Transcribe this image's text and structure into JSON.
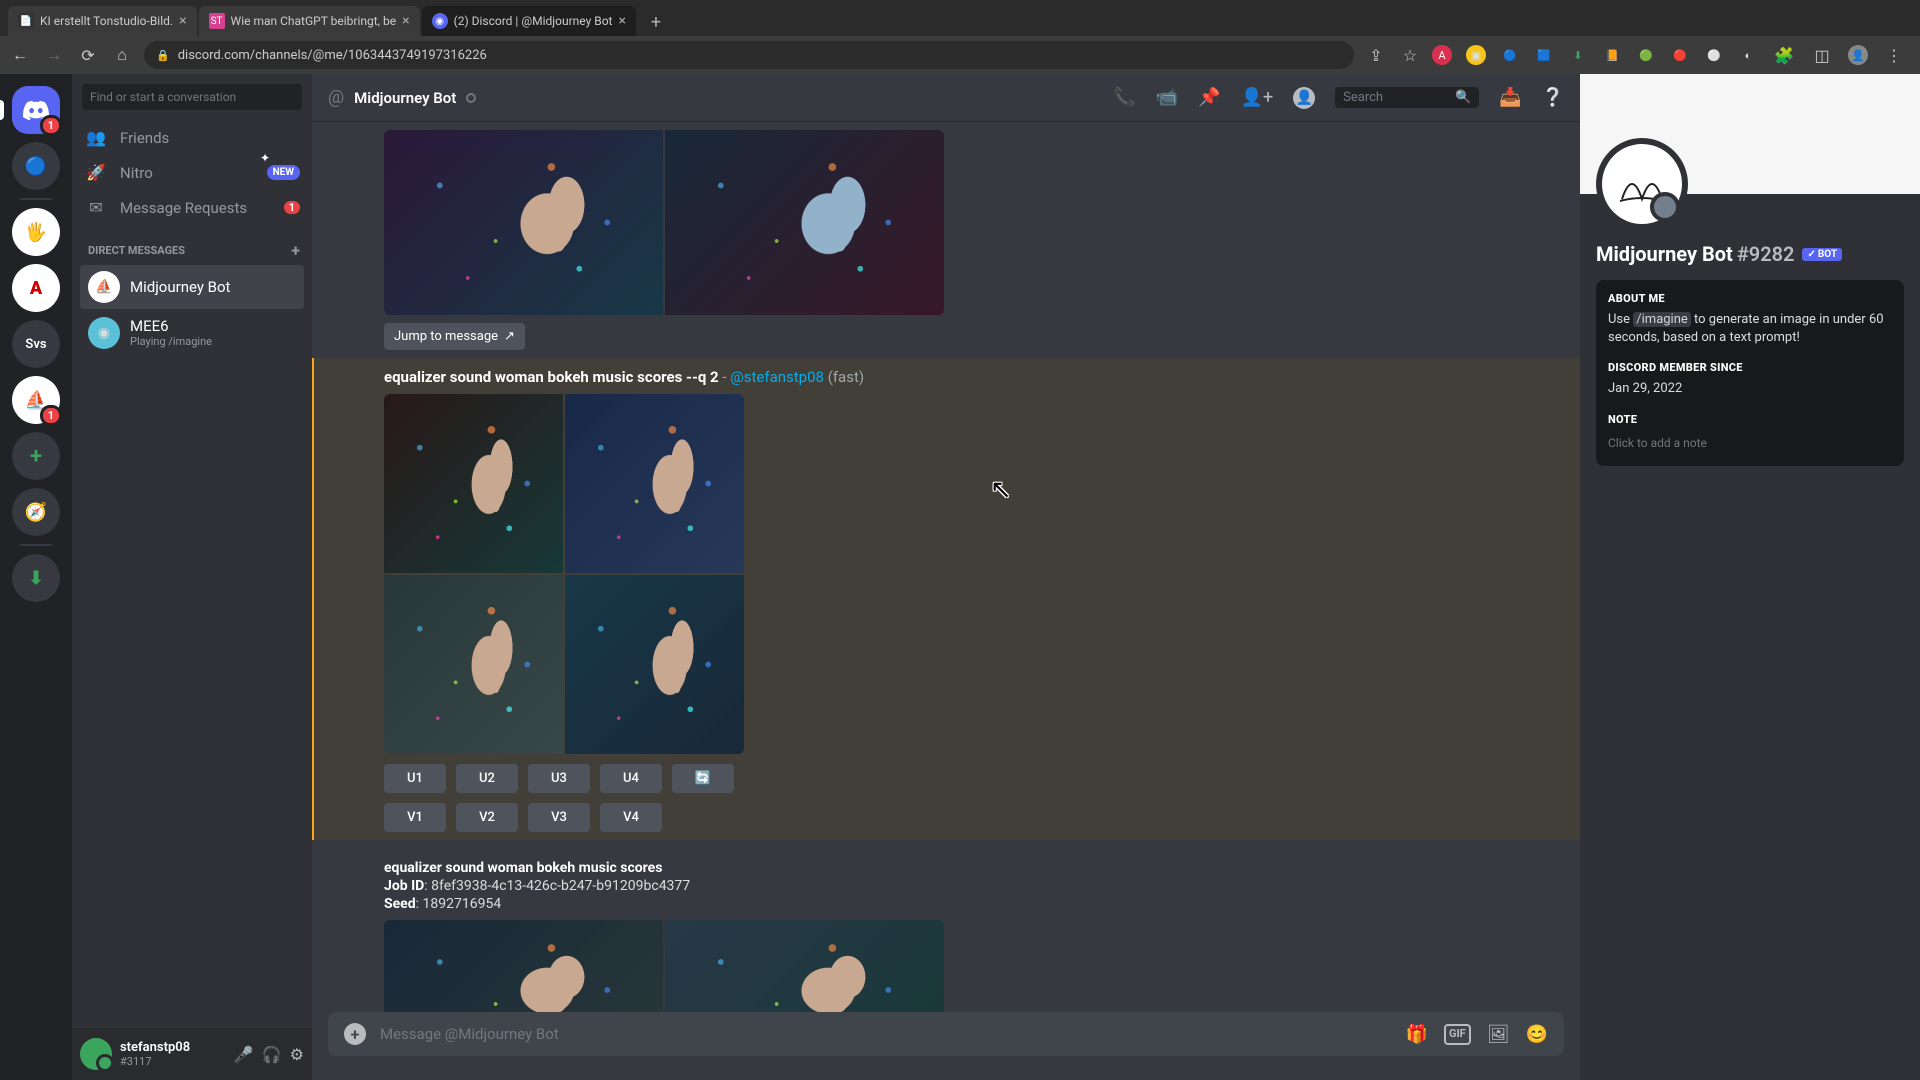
{
  "browser": {
    "tabs": [
      {
        "title": "KI erstellt Tonstudio-Bild.",
        "active": false
      },
      {
        "title": "Wie man ChatGPT beibringt, be",
        "active": false
      },
      {
        "title": "(2) Discord | @Midjourney Bot",
        "active": true
      }
    ],
    "url": "discord.com/channels/@me/1063443749197316226"
  },
  "dm_column": {
    "search_placeholder": "Find or start a conversation",
    "friends": "Friends",
    "nitro": "Nitro",
    "nitro_badge": "NEW",
    "message_requests": "Message Requests",
    "message_requests_count": "1",
    "header": "DIRECT MESSAGES",
    "channels": [
      {
        "name": "Midjourney Bot",
        "sub": "",
        "active": true
      },
      {
        "name": "MEE6",
        "sub": "Playing /imagine",
        "active": false
      }
    ]
  },
  "guilds": {
    "svs_label": "Svs",
    "badge1": "1",
    "badge2": "1"
  },
  "user": {
    "name": "stefanstp08",
    "tag": "#3117"
  },
  "chat": {
    "title": "Midjourney Bot",
    "search_placeholder": "Search",
    "jump_label": "Jump to message",
    "msg1": {
      "prompt_bold": "equalizer sound woman bokeh music scores --q 2",
      "mention": "@stefanstp08",
      "mode": "(fast)"
    },
    "buttons": {
      "u1": "U1",
      "u2": "U2",
      "u3": "U3",
      "u4": "U4",
      "v1": "V1",
      "v2": "V2",
      "v3": "V3",
      "v4": "V4"
    },
    "msg2": {
      "title": "equalizer sound woman bokeh music scores",
      "jobid_label": "Job ID",
      "jobid": "8fef3938-4c13-426c-b247-b91209bc4377",
      "seed_label": "Seed",
      "seed": "1892716954"
    },
    "input_placeholder": "Message @Midjourney Bot",
    "gif_label": "GIF"
  },
  "profile": {
    "name": "Midjourney Bot",
    "discriminator": "#9282",
    "bot_label": "BOT",
    "about_h": "ABOUT ME",
    "about_pre": "Use ",
    "about_cmd": "/imagine",
    "about_post": " to generate an image in under 60 seconds, based on a text prompt!",
    "member_h": "DISCORD MEMBER SINCE",
    "member_date": "Jan 29, 2022",
    "note_h": "NOTE",
    "note_placeholder": "Click to add a note"
  }
}
